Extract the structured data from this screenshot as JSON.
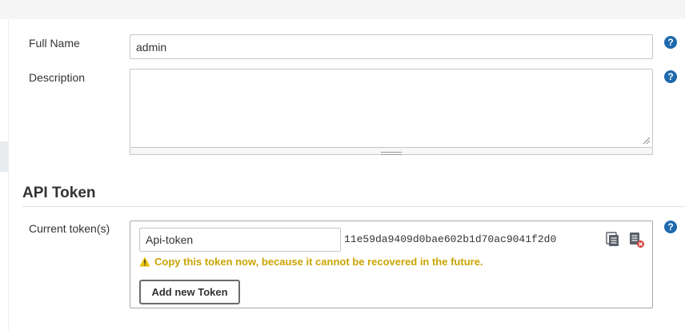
{
  "form": {
    "full_name": {
      "label": "Full Name",
      "value": "admin"
    },
    "description": {
      "label": "Description",
      "value": ""
    }
  },
  "help_icon": {
    "glyph": "?",
    "color": "#1e6aad"
  },
  "api_token": {
    "section_title": "API Token",
    "current_tokens_label": "Current token(s)",
    "token_name": "Api-token",
    "token_value": "11e59da9409d0bae602b1d70ac9041f2d0",
    "warning_text": "Copy this token now, because it cannot be recovered in the future.",
    "warning_color": "#c9a400",
    "add_button_label": "Add new Token",
    "copy_icon": "copy-icon",
    "revoke_icon": "revoke-icon"
  }
}
